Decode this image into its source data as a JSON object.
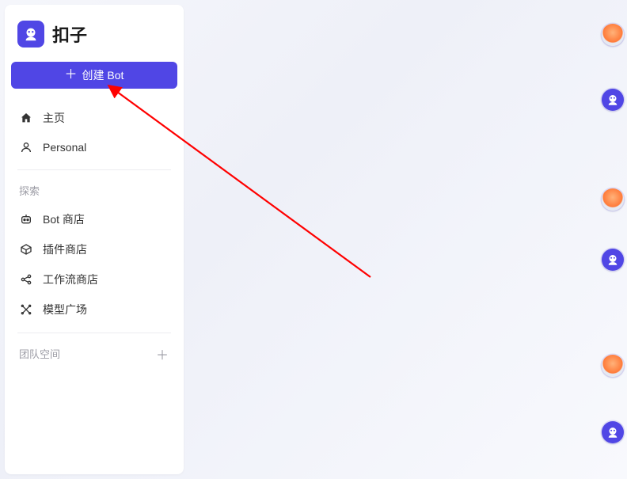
{
  "brand": {
    "title": "扣子"
  },
  "create_button": {
    "label": "创建 Bot"
  },
  "nav_main": [
    {
      "label": "主页"
    },
    {
      "label": "Personal"
    }
  ],
  "sections": {
    "explore": {
      "label": "探索",
      "items": [
        {
          "label": "Bot 商店"
        },
        {
          "label": "插件商店"
        },
        {
          "label": "工作流商店"
        },
        {
          "label": "模型广场"
        }
      ]
    },
    "team": {
      "label": "团队空间"
    }
  },
  "right_rail_items": [
    "balloon",
    "bot",
    "balloon",
    "bot",
    "balloon",
    "bot"
  ],
  "colors": {
    "primary": "#5046e5",
    "arrow": "#ff0000"
  }
}
